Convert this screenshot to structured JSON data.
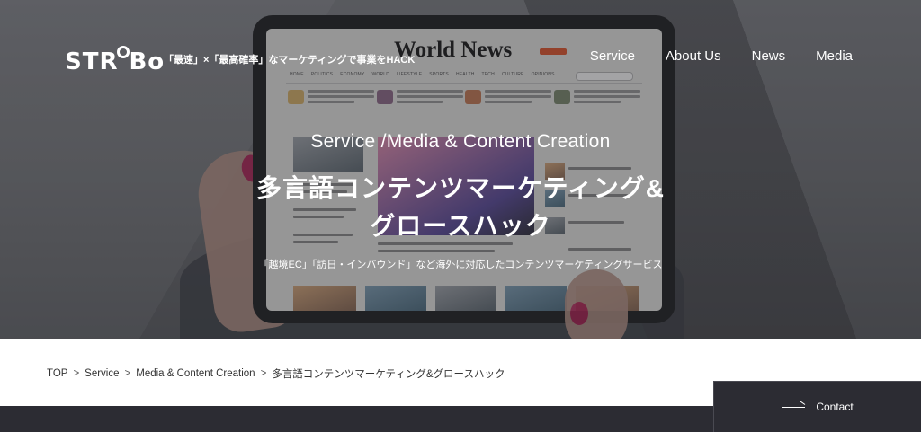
{
  "header": {
    "logo_text": "STROBo",
    "tagline": "「最速」×「最高確率」なマーケティングで事業をHACK",
    "nav": [
      {
        "label": "Service"
      },
      {
        "label": "About Us"
      },
      {
        "label": "News"
      },
      {
        "label": "Media"
      }
    ]
  },
  "hero_image": {
    "newspaper_title": "World News",
    "nav_items": [
      "HOME",
      "POLITICS",
      "ECONOMY",
      "WORLD",
      "LIFESTYLE",
      "SPORTS",
      "HEALTH",
      "TECH",
      "CULTURE",
      "OPINIONS"
    ]
  },
  "hero": {
    "category": "Service /Media & Content Creation",
    "title_line1": "多言語コンテンツマーケティング&",
    "title_line2": "グロースハック",
    "subtitle": "「越境EC」「訪日・インバウンド」など海外に対応したコンテンツマーケティングサービス"
  },
  "breadcrumb": {
    "items": [
      {
        "label": "TOP"
      },
      {
        "label": "Service"
      },
      {
        "label": "Media & Content Creation"
      },
      {
        "label": "多言語コンテンツマーケティング&グロースハック"
      }
    ],
    "separator": ">"
  },
  "contact": {
    "label": "Contact"
  },
  "colors": {
    "dark_band": "#2c2c33",
    "text_white": "#ffffff",
    "nail_accent": "#b51f55"
  }
}
